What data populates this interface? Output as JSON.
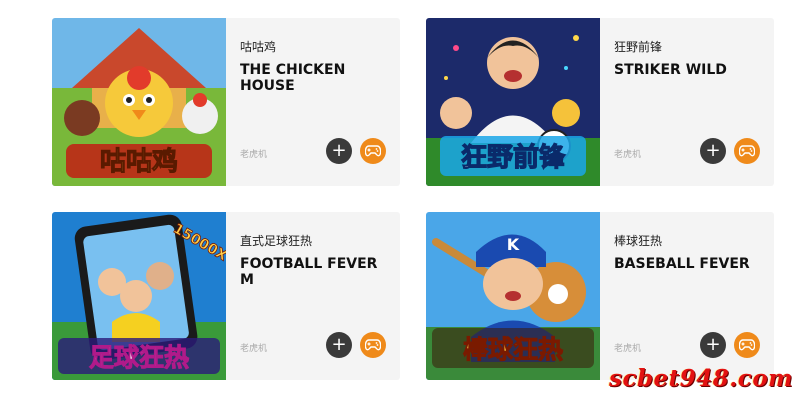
{
  "games": [
    {
      "name_cn": "咕咕鸡",
      "name_en": "THE CHICKEN HOUSE",
      "category": "老虎机",
      "thumb_title": "咕咕鸡"
    },
    {
      "name_cn": "狂野前锋",
      "name_en": "STRIKER WILD",
      "category": "老虎机",
      "thumb_title": "狂野前锋"
    },
    {
      "name_cn": "直式足球狂热",
      "name_en": "FOOTBALL FEVER M",
      "category": "老虎机",
      "thumb_title": "足球狂热",
      "thumb_badge": "15000X"
    },
    {
      "name_cn": "棒球狂热",
      "name_en": "BASEBALL FEVER",
      "category": "老虎机",
      "thumb_title": "棒球狂热"
    }
  ],
  "buttons": {
    "add_label": "+"
  },
  "watermark": "scbet948.com",
  "colors": {
    "play": "#ef8a1a",
    "add": "#3a3a3a",
    "card_bg": "#f4f4f4"
  },
  "icons": {
    "add": "plus-icon",
    "play": "gamepad-icon"
  }
}
